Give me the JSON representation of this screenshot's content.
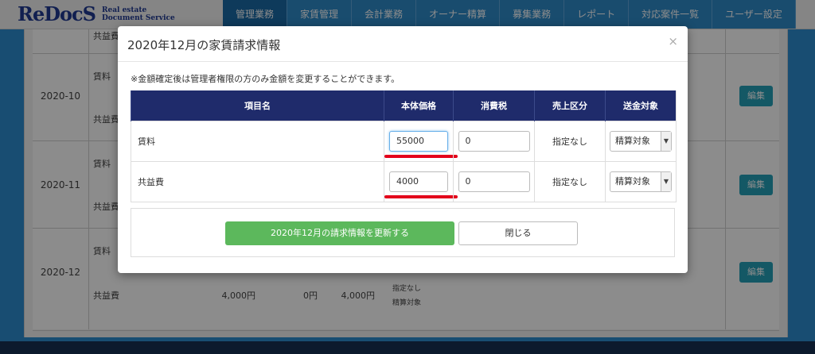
{
  "brand": {
    "logo_text": "ReDocS",
    "tagline_line1": "Real estate",
    "tagline_line2": "Document Service"
  },
  "nav": {
    "items": [
      {
        "label": "管理業務",
        "active": true
      },
      {
        "label": "家賃管理",
        "active": false
      },
      {
        "label": "会計業務",
        "active": false
      },
      {
        "label": "オーナー精算",
        "active": false
      },
      {
        "label": "募集業務",
        "active": false
      },
      {
        "label": "レポート",
        "active": false
      },
      {
        "label": "対応案件一覧",
        "active": false
      },
      {
        "label": "ユーザー設定",
        "active": false
      }
    ]
  },
  "background_table": {
    "top_partial_label": "共益費",
    "rows": [
      {
        "month": "2020-10",
        "item1": "賃料",
        "item2": "共益費",
        "edit_label": "編集"
      },
      {
        "month": "2020-11",
        "item1": "賃料",
        "item2": "共益費",
        "edit_label": "編集"
      },
      {
        "month": "2020-12",
        "item1": "賃料",
        "item2": "共益費",
        "edit_label": "編集"
      }
    ],
    "last_row_values": {
      "price": "4,000円",
      "tax": "0円",
      "total": "4,000円",
      "status1": "指定なし",
      "status2": "精算対象"
    }
  },
  "modal": {
    "title": "2020年12月の家賃請求情報",
    "close_symbol": "×",
    "notice": "※金額確定後は管理者権限の方のみ金額を変更することができます。",
    "columns": [
      "項目名",
      "本体価格",
      "消費税",
      "売上区分",
      "送金対象"
    ],
    "rows": [
      {
        "name": "賃料",
        "price": "55000",
        "tax": "0",
        "category": "指定なし",
        "target": "精算対象"
      },
      {
        "name": "共益費",
        "price": "4000",
        "tax": "0",
        "category": "指定なし",
        "target": "精算対象"
      }
    ],
    "update_button": "2020年12月の請求情報を更新する",
    "close_button": "閉じる"
  },
  "colors": {
    "nav_bg": "#2f8ac9",
    "table_header": "#1f2b6b",
    "update_button": "#5cb85c",
    "annotation_underline": "#e3001b"
  }
}
